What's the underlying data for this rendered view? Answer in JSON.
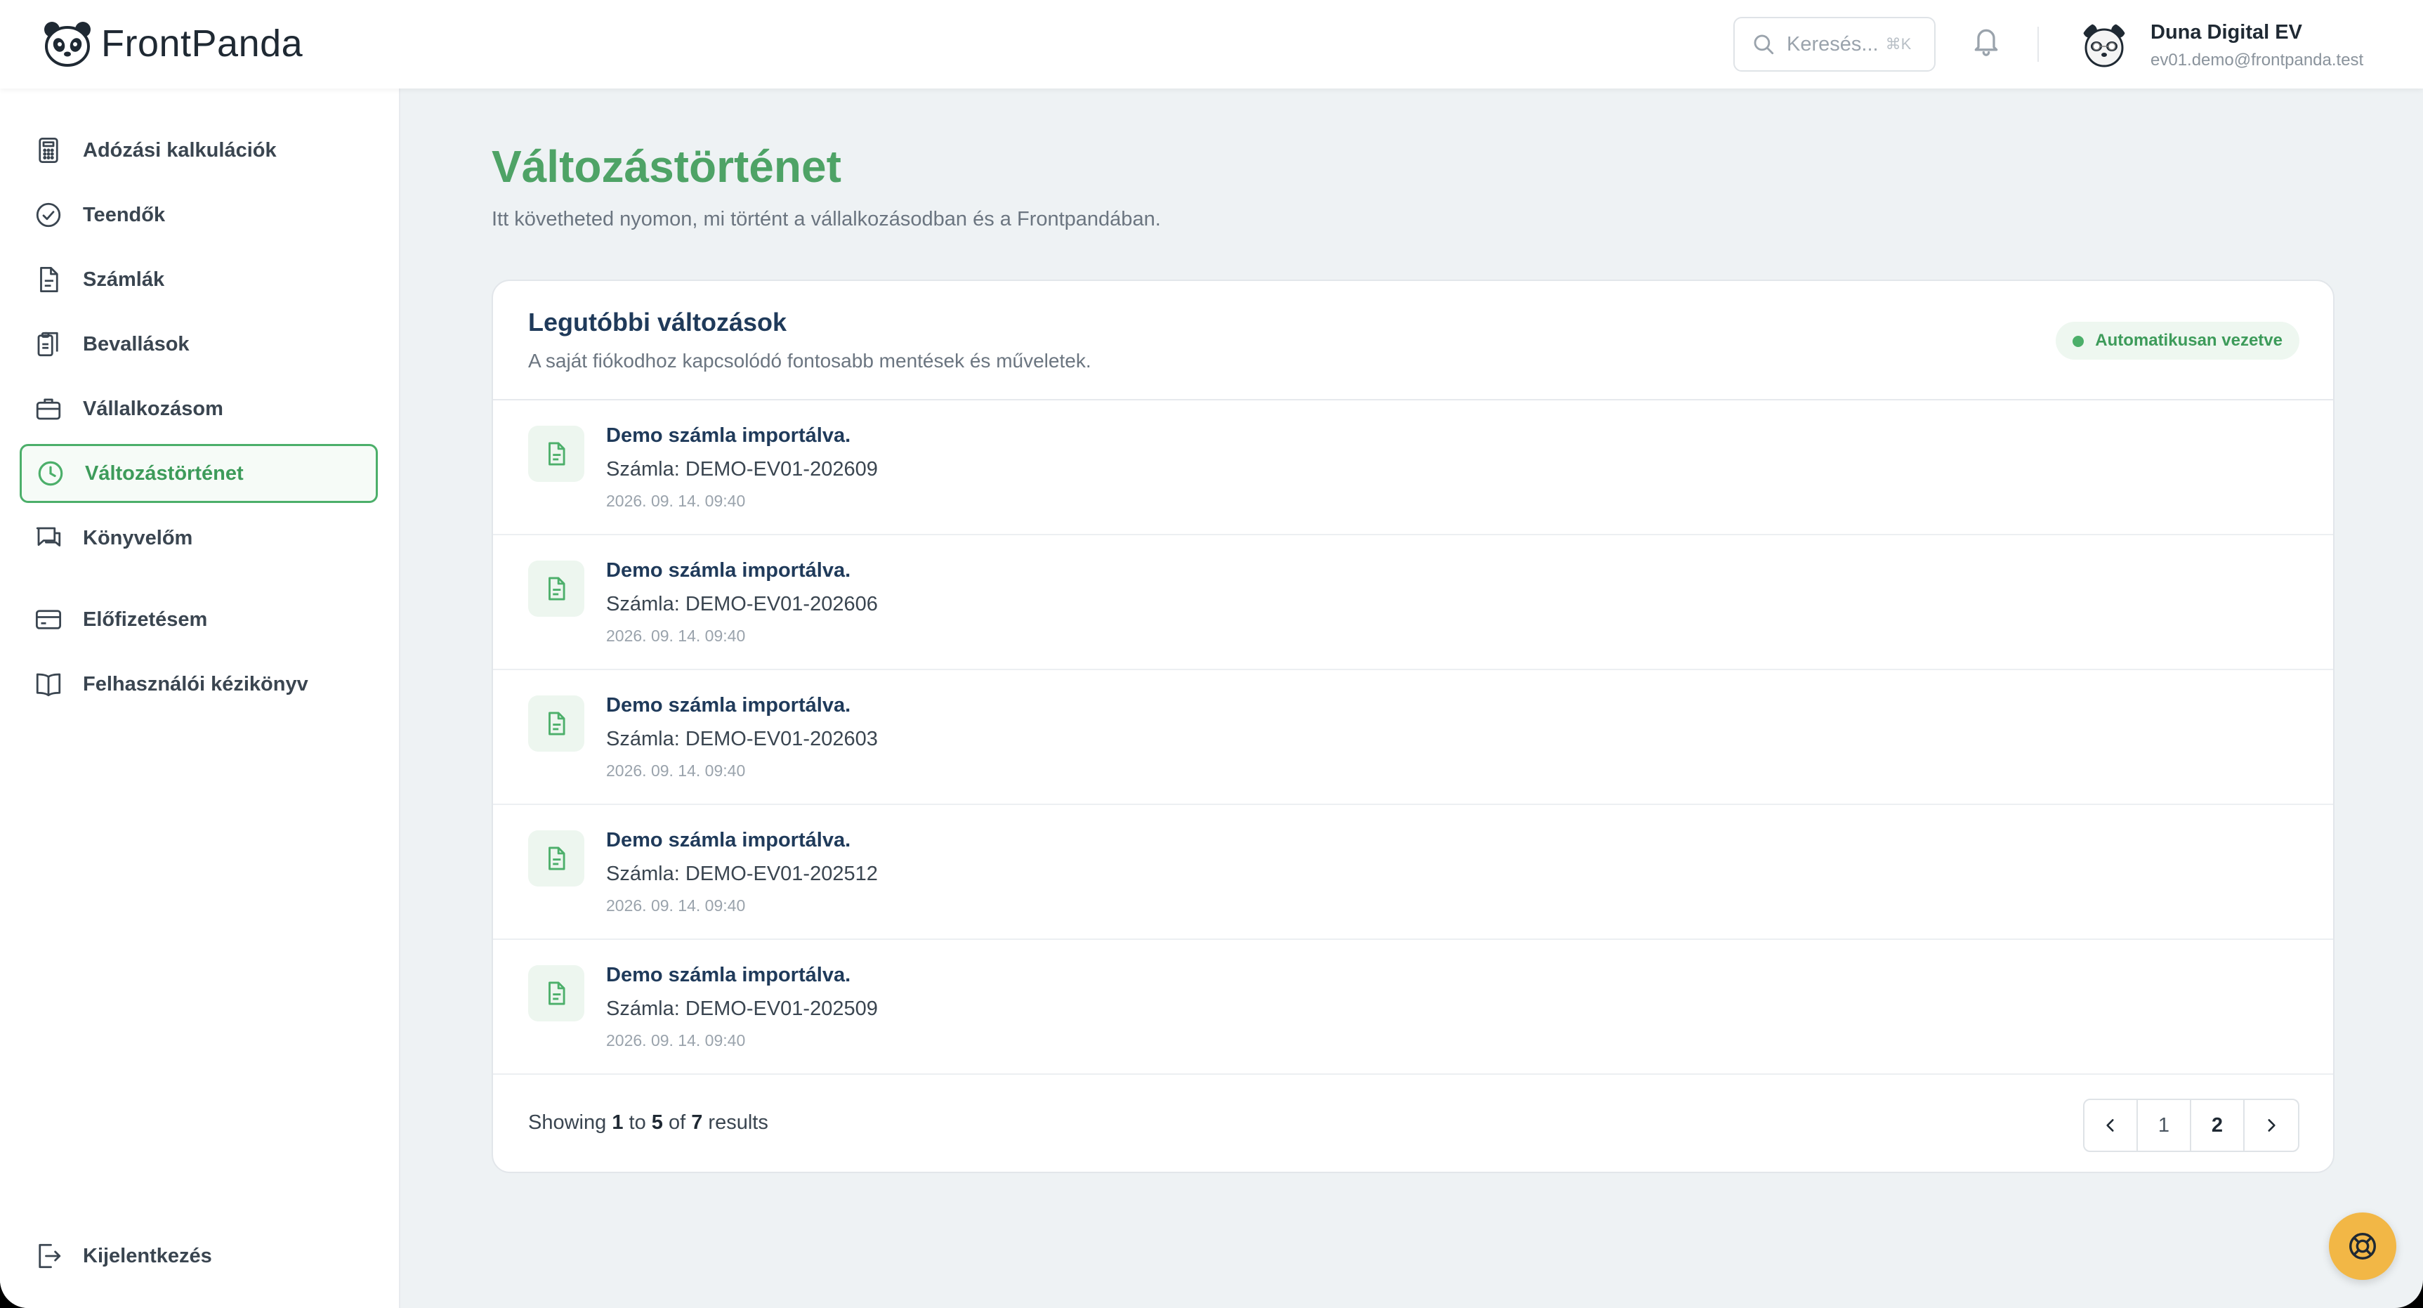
{
  "app": {
    "name": "FrontPanda"
  },
  "header": {
    "search_placeholder": "Keresés...",
    "search_shortcut": "⌘K",
    "user": {
      "name": "Duna Digital EV",
      "email": "ev01.demo@frontpanda.test"
    }
  },
  "sidebar": {
    "items": [
      {
        "label": "Adózási kalkulációk",
        "icon": "calculator-icon"
      },
      {
        "label": "Teendők",
        "icon": "check-circle-icon"
      },
      {
        "label": "Számlák",
        "icon": "document-icon"
      },
      {
        "label": "Bevallások",
        "icon": "clipboard-icon"
      },
      {
        "label": "Vállalkozásom",
        "icon": "briefcase-icon"
      },
      {
        "label": "Változástörténet",
        "icon": "clock-icon",
        "active": true
      },
      {
        "label": "Könyvelőm",
        "icon": "chat-icon"
      },
      {
        "label": "Előfizetésem",
        "icon": "credit-card-icon"
      },
      {
        "label": "Felhasználói kézikönyv",
        "icon": "book-icon"
      }
    ],
    "logout_label": "Kijelentkezés"
  },
  "page": {
    "title": "Változástörténet",
    "subtitle": "Itt követheted nyomon, mi történt a vállalkozásodban és a Frontpandában."
  },
  "card": {
    "title": "Legutóbbi változások",
    "subtitle": "A saját fiókodhoz kapcsolódó fontosabb mentések és műveletek.",
    "badge": "Automatikusan vezetve",
    "entries": [
      {
        "title": "Demo számla importálva.",
        "detail": "Számla: DEMO-EV01-202609",
        "time": "2026. 09. 14. 09:40"
      },
      {
        "title": "Demo számla importálva.",
        "detail": "Számla: DEMO-EV01-202606",
        "time": "2026. 09. 14. 09:40"
      },
      {
        "title": "Demo számla importálva.",
        "detail": "Számla: DEMO-EV01-202603",
        "time": "2026. 09. 14. 09:40"
      },
      {
        "title": "Demo számla importálva.",
        "detail": "Számla: DEMO-EV01-202512",
        "time": "2026. 09. 14. 09:40"
      },
      {
        "title": "Demo számla importálva.",
        "detail": "Számla: DEMO-EV01-202509",
        "time": "2026. 09. 14. 09:40"
      }
    ],
    "footer": {
      "showing_prefix": "Showing",
      "from": "1",
      "to_word": "to",
      "to": "5",
      "of_word": "of",
      "total": "7",
      "results_word": "results"
    },
    "pagination": {
      "pages": [
        "1",
        "2"
      ],
      "current": "2"
    }
  },
  "colors": {
    "accent": "#4caf6a",
    "title_green": "#4ea366",
    "help_button": "#f2b746"
  }
}
